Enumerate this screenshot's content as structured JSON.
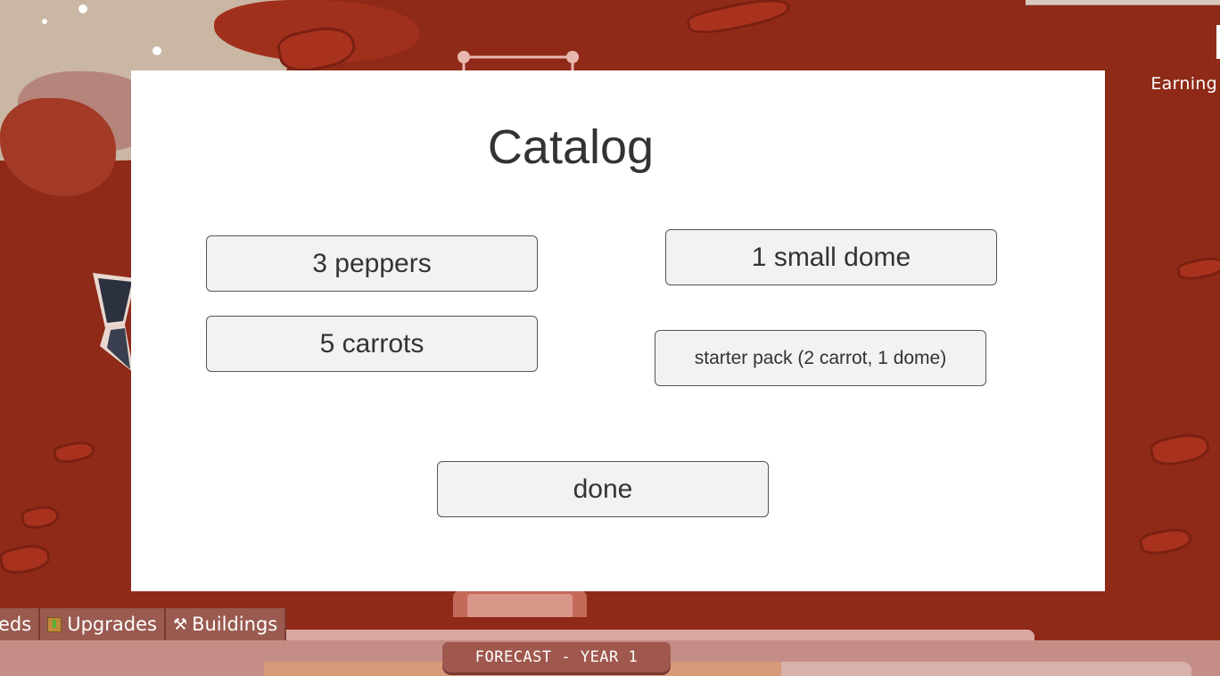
{
  "hud": {
    "earning_label": "Earning"
  },
  "modal": {
    "title": "Catalog",
    "buttons": {
      "peppers": "3 peppers",
      "carrots": "5 carrots",
      "small_dome": "1 small dome",
      "starter_pack": "starter pack (2 carrot, 1 dome)",
      "done": "done"
    }
  },
  "tabs": [
    {
      "label": "eds",
      "icon": ""
    },
    {
      "label": "Upgrades",
      "icon": "crate-icon"
    },
    {
      "label": "Buildings",
      "icon": "hammer-pick-icon"
    }
  ],
  "forecast": {
    "label": "FORECAST - YEAR 1"
  },
  "colors": {
    "terrain": "#8f2a18",
    "modal_bg": "#ffffff",
    "button_bg": "#f2f2f2",
    "tab_bg": "#9a5a50"
  }
}
